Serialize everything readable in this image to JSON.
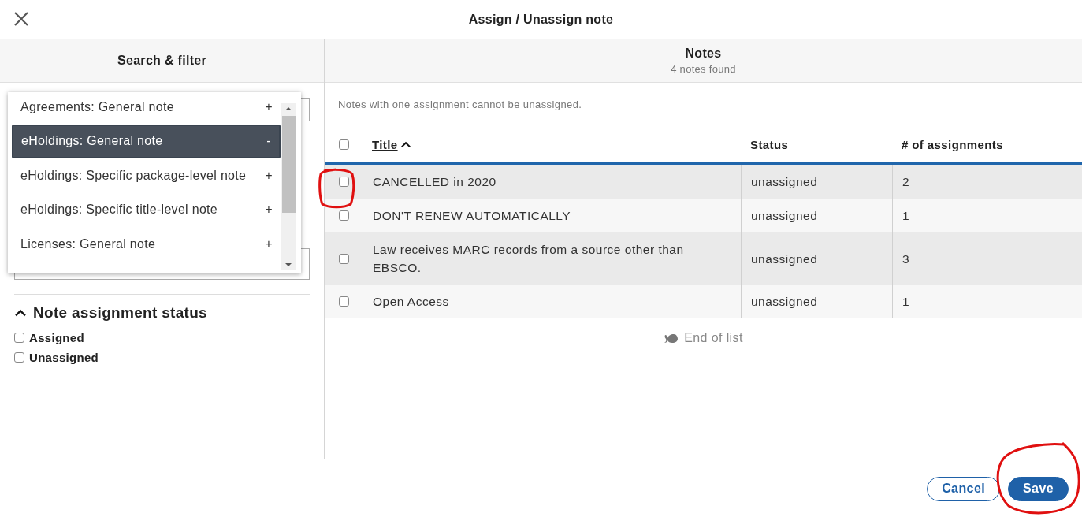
{
  "dialog": {
    "title": "Assign / Unassign note"
  },
  "filter_panel": {
    "title": "Search & filter",
    "note_type_menu": {
      "items": [
        {
          "label": "Agreements: General note",
          "sign": "+",
          "selected": false
        },
        {
          "label": "eHoldings: General note",
          "sign": "-",
          "selected": true
        },
        {
          "label": "eHoldings: Specific package-level note",
          "sign": "+",
          "selected": false
        },
        {
          "label": "eHoldings: Specific title-level note",
          "sign": "+",
          "selected": false
        },
        {
          "label": "Licenses: General note",
          "sign": "+",
          "selected": false
        }
      ]
    },
    "status_section": {
      "title": "Note assignment status",
      "expanded": true,
      "options": [
        {
          "label": "Assigned",
          "checked": false
        },
        {
          "label": "Unassigned",
          "checked": false
        }
      ]
    }
  },
  "notes_panel": {
    "title": "Notes",
    "count": "4 notes found",
    "hint": "Notes with one assignment cannot be unassigned.",
    "select_all": {
      "checked": false
    },
    "columns": [
      {
        "label": "Title",
        "sorted_ascending": true
      },
      {
        "label": "Status"
      },
      {
        "label": "# of assignments"
      }
    ],
    "rows": [
      {
        "checked": false,
        "title": "CANCELLED in 2020",
        "status": "unassigned",
        "assignments": "2"
      },
      {
        "checked": false,
        "title": "DON'T RENEW AUTOMATICALLY",
        "status": "unassigned",
        "assignments": "1"
      },
      {
        "checked": false,
        "title": "Law receives MARC records from a source other than EBSCO.",
        "status": "unassigned",
        "assignments": "3"
      },
      {
        "checked": false,
        "title": "Open Access",
        "status": "unassigned",
        "assignments": "1"
      }
    ],
    "end_of_list": "End of list"
  },
  "footer": {
    "buttons": [
      {
        "label": "Cancel",
        "kind": "secondary"
      },
      {
        "label": "Save",
        "kind": "primary"
      }
    ]
  }
}
